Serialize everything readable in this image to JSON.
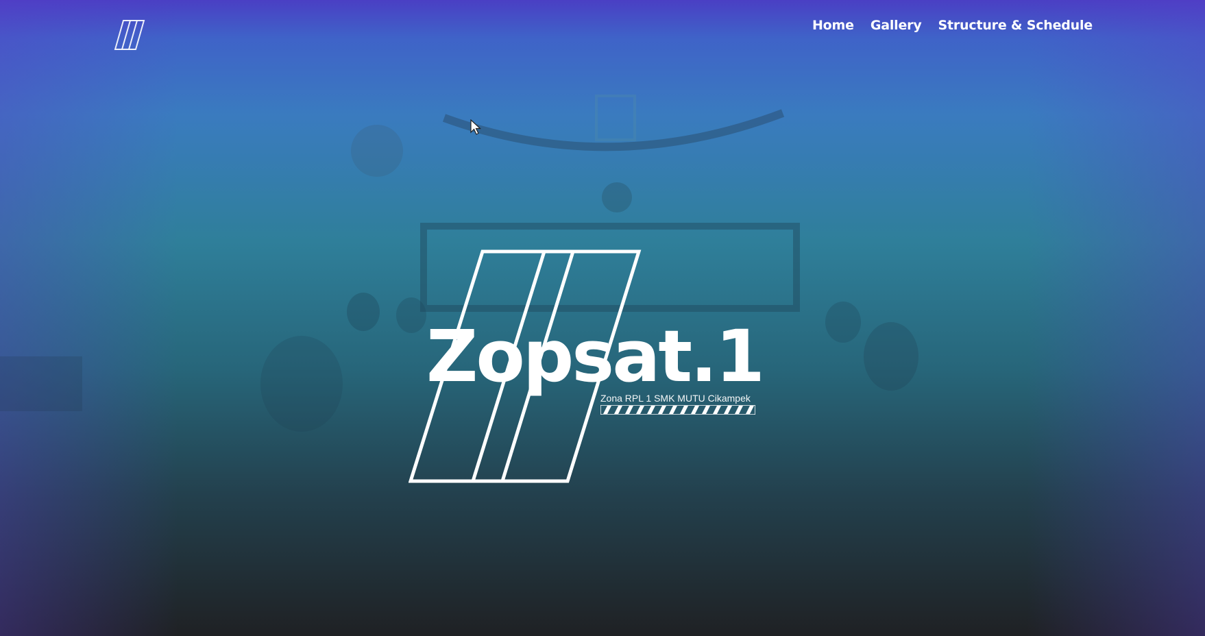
{
  "nav": {
    "items": [
      "Home",
      "Gallery",
      "Structure & Schedule"
    ]
  },
  "hero": {
    "logo_title": "Zopsat.1",
    "logo_subtitle": "Zona RPL 1 SMK MUTU Cikampek"
  },
  "icons": {
    "brand": "brand-slash-logo-icon",
    "cursor": "mouse-pointer-icon"
  },
  "colors": {
    "top_gradient": "#4a3fc4",
    "mid_gradient": "#2f7f9a",
    "bottom_gradient": "#1f2124",
    "text": "#ffffff"
  }
}
